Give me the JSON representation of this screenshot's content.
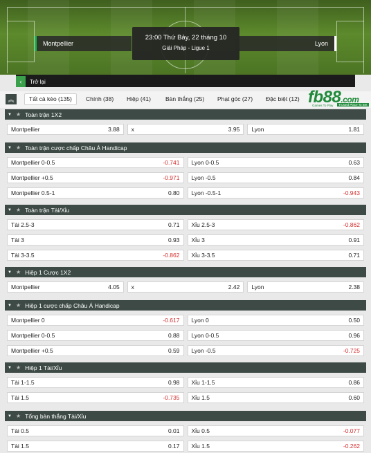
{
  "match": {
    "home": "Montpellier",
    "away": "Lyon",
    "time": "23:00 Thứ Bảy, 22 tháng 10",
    "league": "Giải Pháp - Ligue 1"
  },
  "back_label": "Trở lại",
  "tabs": [
    {
      "label": "Tất cả kèo (135)"
    },
    {
      "label": "Chính (38)"
    },
    {
      "label": "Hiệp (41)"
    },
    {
      "label": "Bàn thắng (25)"
    },
    {
      "label": "Phạt góc (27)"
    },
    {
      "label": "Đặc biệt (12)"
    }
  ],
  "logo": {
    "brand": "fb88",
    "suffix": ".com",
    "tagline1": "Games To Play",
    "tagline2": "Trusted Place To Bet"
  },
  "colors": {
    "header": "#3d4a45",
    "negative": "#d32f2f",
    "brand": "#1f8a3a"
  },
  "sections": [
    {
      "title": "Toàn trận 1X2",
      "rows": [
        [
          {
            "label": "Montpellier",
            "value": "3.88"
          },
          {
            "label": "x",
            "value": "3.95"
          },
          {
            "label": "Lyon",
            "value": "1.81"
          }
        ]
      ]
    },
    {
      "title": "Toàn trận cược chấp Châu Á Handicap",
      "rows": [
        [
          {
            "label": "Montpellier 0-0.5",
            "value": "-0.741"
          },
          {
            "label": "Lyon 0-0.5",
            "value": "0.63"
          }
        ],
        [
          {
            "label": "Montpellier +0.5",
            "value": "-0.971"
          },
          {
            "label": "Lyon -0.5",
            "value": "0.84"
          }
        ],
        [
          {
            "label": "Montpellier 0.5-1",
            "value": "0.80"
          },
          {
            "label": "Lyon -0.5-1",
            "value": "-0.943"
          }
        ]
      ]
    },
    {
      "title": "Toàn trận Tài/Xỉu",
      "rows": [
        [
          {
            "label": "Tài 2.5-3",
            "value": "0.71"
          },
          {
            "label": "Xỉu 2.5-3",
            "value": "-0.862"
          }
        ],
        [
          {
            "label": "Tài 3",
            "value": "0.93"
          },
          {
            "label": "Xỉu 3",
            "value": "0.91"
          }
        ],
        [
          {
            "label": "Tài 3-3.5",
            "value": "-0.862"
          },
          {
            "label": "Xỉu 3-3.5",
            "value": "0.71"
          }
        ]
      ]
    },
    {
      "title": "Hiệp 1 Cược 1X2",
      "rows": [
        [
          {
            "label": "Montpellier",
            "value": "4.05"
          },
          {
            "label": "x",
            "value": "2.42"
          },
          {
            "label": "Lyon",
            "value": "2.38"
          }
        ]
      ]
    },
    {
      "title": "Hiệp 1 cược chấp Châu Á Handicap",
      "rows": [
        [
          {
            "label": "Montpellier 0",
            "value": "-0.617"
          },
          {
            "label": "Lyon 0",
            "value": "0.50"
          }
        ],
        [
          {
            "label": "Montpellier 0-0.5",
            "value": "0.88"
          },
          {
            "label": "Lyon 0-0.5",
            "value": "0.96"
          }
        ],
        [
          {
            "label": "Montpellier +0.5",
            "value": "0.59"
          },
          {
            "label": "Lyon -0.5",
            "value": "-0.725"
          }
        ]
      ]
    },
    {
      "title": "Hiệp 1 Tài/Xỉu",
      "rows": [
        [
          {
            "label": "Tài 1-1.5",
            "value": "0.98"
          },
          {
            "label": "Xỉu 1-1.5",
            "value": "0.86"
          }
        ],
        [
          {
            "label": "Tài 1.5",
            "value": "-0.735"
          },
          {
            "label": "Xỉu 1.5",
            "value": "0.60"
          }
        ]
      ]
    },
    {
      "title": "Tổng bàn thắng Tài/Xỉu",
      "rows": [
        [
          {
            "label": "Tài 0.5",
            "value": "0.01"
          },
          {
            "label": "Xỉu 0.5",
            "value": "-0.077"
          }
        ],
        [
          {
            "label": "Tài 1.5",
            "value": "0.17"
          },
          {
            "label": "Xỉu 1.5",
            "value": "-0.262"
          }
        ]
      ]
    }
  ]
}
